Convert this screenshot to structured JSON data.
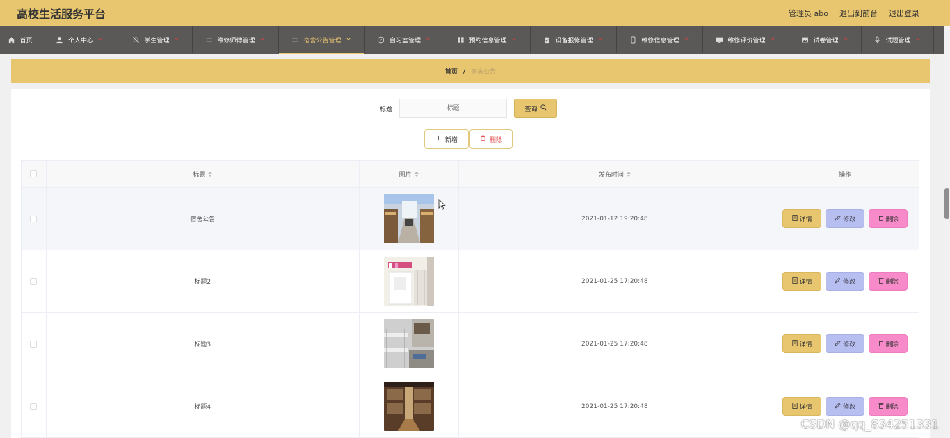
{
  "app": {
    "title": "高校生活服务平台"
  },
  "header": {
    "user": "管理员 abo",
    "front_link": "退出到前台",
    "logout": "退出登录"
  },
  "nav": [
    {
      "label": "首页",
      "icon": "home-icon",
      "dropdown": false,
      "active": false
    },
    {
      "label": "个人中心",
      "icon": "user-icon",
      "dropdown": true,
      "active": false
    },
    {
      "label": "学生管理",
      "icon": "bell-off-icon",
      "dropdown": true,
      "active": false
    },
    {
      "label": "维修师傅管理",
      "icon": "menu-icon",
      "dropdown": true,
      "active": false
    },
    {
      "label": "宿舍公告管理",
      "icon": "menu-icon",
      "dropdown": true,
      "active": true
    },
    {
      "label": "自习室管理",
      "icon": "compass-icon",
      "dropdown": true,
      "active": false
    },
    {
      "label": "预约信息管理",
      "icon": "grid-icon",
      "dropdown": true,
      "active": false
    },
    {
      "label": "设备报修管理",
      "icon": "clipboard-icon",
      "dropdown": true,
      "active": false
    },
    {
      "label": "维修信息管理",
      "icon": "phone-icon",
      "dropdown": true,
      "active": false
    },
    {
      "label": "维修评价管理",
      "icon": "monitor-icon",
      "dropdown": true,
      "active": false
    },
    {
      "label": "试卷管理",
      "icon": "image-icon",
      "dropdown": true,
      "active": false
    },
    {
      "label": "试题管理",
      "icon": "microphone-icon",
      "dropdown": true,
      "active": false
    }
  ],
  "breadcrumb": {
    "home": "首页",
    "separator": "/",
    "current": "宿舍公告"
  },
  "search": {
    "label": "标题",
    "placeholder": "标题",
    "button": "查询"
  },
  "actions": {
    "add": "新增",
    "delete": "删除"
  },
  "table": {
    "columns": [
      "标题",
      "图片",
      "发布时间",
      "操作"
    ],
    "rows": [
      {
        "title": "宿舍公告",
        "image": "dorm-photo-1",
        "time": "2021-01-12 19:20:48"
      },
      {
        "title": "标题2",
        "image": "dorm-photo-2",
        "time": "2021-01-25 17:20:48"
      },
      {
        "title": "标题3",
        "image": "dorm-photo-3",
        "time": "2021-01-25 17:20:48"
      },
      {
        "title": "标题4",
        "image": "dorm-photo-4",
        "time": "2021-01-25 17:20:48"
      }
    ],
    "row_actions": {
      "detail": "详情",
      "edit": "修改",
      "remove": "删除"
    }
  },
  "watermark": "CSDN @qq_834251331",
  "colors": {
    "accent": "#e8c56f",
    "nav_bg": "#5b5858",
    "edit": "#b7bff0",
    "remove": "#f78ac8"
  }
}
